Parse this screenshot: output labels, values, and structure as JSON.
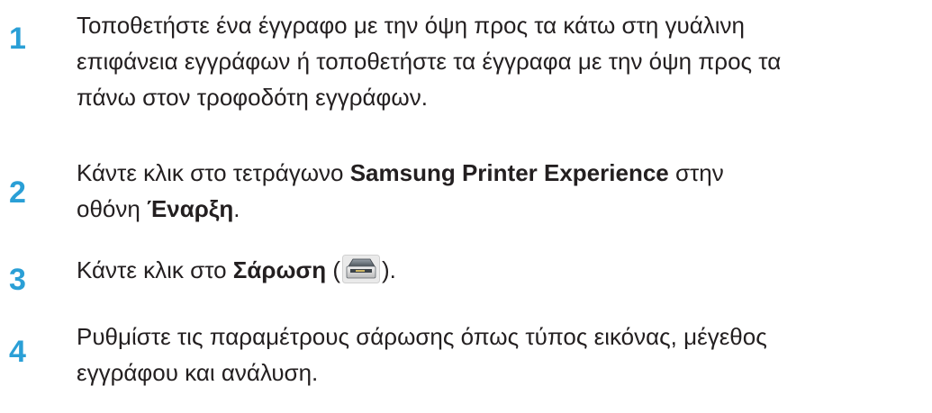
{
  "steps": [
    {
      "number": "1",
      "lines": [
        "Τοποθετήστε ένα έγγραφο με την όψη προς τα κάτω στη γυάλινη",
        "επιφάνεια εγγράφων ή τοποθετήστε τα έγγραφα με την όψη προς τα",
        "πάνω στον τροφοδότη εγγράφων."
      ]
    },
    {
      "number": "2",
      "prefix": "Κάντε κλικ στο τετράγωνο ",
      "bold1": "Samsung Printer Experience",
      "mid": " στην",
      "line2_prefix": "οθόνη ",
      "bold2": "Έναρξη",
      "line2_suffix": "."
    },
    {
      "number": "3",
      "prefix": "Κάντε κλικ στο ",
      "bold": "Σάρωση",
      "open_paren": " (",
      "icon": "scanner-icon",
      "close_paren": ")."
    },
    {
      "number": "4",
      "lines": [
        "Ρυθμίστε τις παραμέτρους σάρωσης όπως τύπος εικόνας, μέγεθος",
        "εγγράφου και ανάλυση."
      ]
    }
  ],
  "colors": {
    "step_number": "#2a9fd6",
    "body_text": "#231f20"
  }
}
